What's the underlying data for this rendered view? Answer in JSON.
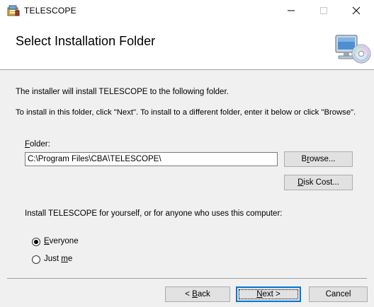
{
  "window": {
    "title": "TELESCOPE",
    "controls": {
      "minimize": "—",
      "maximize": "☐",
      "close": "✕"
    }
  },
  "banner": {
    "title": "Select Installation Folder"
  },
  "body": {
    "intro_line": "The installer will install TELESCOPE to the following folder.",
    "instructions_line": "To install in this folder, click \"Next\". To install to a different folder, enter it below or click \"Browse\"."
  },
  "folder": {
    "label_accel": "F",
    "label_rest": "older:",
    "value": "C:\\Program Files\\CBA\\TELESCOPE\\"
  },
  "buttons": {
    "browse_pre": "B",
    "browse_accel": "r",
    "browse_post": "owse...",
    "disk_cost_accel": "D",
    "disk_cost_post": "isk Cost...",
    "back_pre": "< ",
    "back_accel": "B",
    "back_post": "ack",
    "next_accel": "N",
    "next_post": "ext >",
    "cancel": "Cancel"
  },
  "scope": {
    "question": "Install TELESCOPE for yourself, or for anyone who uses this computer:",
    "options": [
      {
        "accel": "E",
        "rest": "veryone",
        "selected": true
      },
      {
        "pre": "Just ",
        "accel": "m",
        "rest": "e",
        "selected": false
      }
    ]
  }
}
